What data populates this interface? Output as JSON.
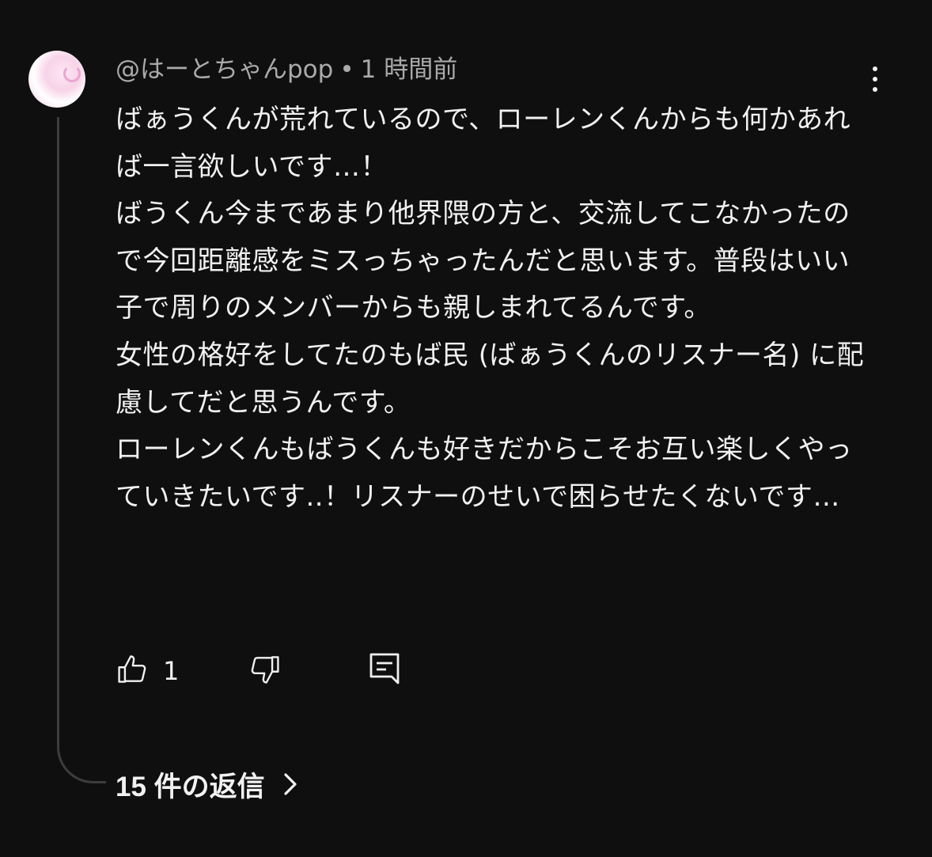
{
  "comment": {
    "author": "@はーとちゃんpop",
    "separator": "•",
    "time": "1 時間前",
    "paragraphs": [
      "ばぁうくんが荒れているので、ローレンくんからも何かあれば一言欲しいです…！",
      "ばうくん今まであまり他界隈の方と、交流してこなかったので今回距離感をミスっちゃったんだと思います。普段はいい子で周りのメンバーからも親しまれてるんです。",
      "女性の格好をしてたのもば民 (ばぁうくんのリスナー名) に配慮してだと思うんです。",
      "ローレンくんもばうくんも好きだからこそお互い楽しくやっていきたいです..！リスナーのせいで困らせたくないです…"
    ],
    "like_count": "1",
    "replies_label": "15 件の返信"
  },
  "icons": {
    "like": "thumbs-up-icon",
    "dislike": "thumbs-down-icon",
    "reply": "comment-icon",
    "more": "more-vertical-icon",
    "expand": "chevron-right-icon"
  },
  "colors": {
    "background": "#0f0f0f",
    "text": "#f1f1f1",
    "meta": "#aaaaaa",
    "thread_line": "#3d3d3d"
  }
}
